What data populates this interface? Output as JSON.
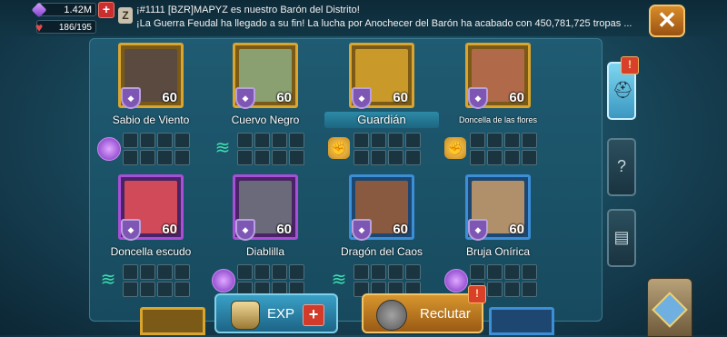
{
  "resources": {
    "gems": "1.42M",
    "stamina": "186/195"
  },
  "chat": {
    "line1": "¡#1111 [BZR]MAPYZ es nuestro Barón del Distrito!",
    "line2": "¡La Guerra Feudal ha llegado a su fin! La lucha por Anochecer del Barón ha acabado con 450,781,725 tropas ..."
  },
  "heroes": [
    {
      "name": "Sabio de Viento",
      "level": "60",
      "frame": "gold",
      "type": "magic",
      "color": "#5a4a40"
    },
    {
      "name": "Cuervo Negro",
      "level": "60",
      "frame": "gold",
      "type": "wind",
      "color": "#8aa070"
    },
    {
      "name": "Guardián",
      "level": "60",
      "frame": "gold",
      "type": "fist",
      "color": "#c99a2a"
    },
    {
      "name": "Doncella de las flores",
      "level": "60",
      "frame": "gold",
      "type": "fist",
      "color": "#b06a4a"
    },
    {
      "name": "Doncella escudo",
      "level": "60",
      "frame": "purple",
      "type": "wind",
      "color": "#d04a5a"
    },
    {
      "name": "Diablilla",
      "level": "60",
      "frame": "purple",
      "type": "magic",
      "color": "#6a6a7a"
    },
    {
      "name": "Dragón del Caos",
      "level": "60",
      "frame": "blue",
      "type": "wind",
      "color": "#8a5a40"
    },
    {
      "name": "Bruja Onírica",
      "level": "60",
      "frame": "blue",
      "type": "magic",
      "color": "#b0906a"
    }
  ],
  "buttons": {
    "exp": "EXP",
    "recruit": "Reclutar",
    "close": "✕",
    "plus": "+",
    "alert": "!"
  },
  "colors": {
    "accent": "#d9a52e",
    "exp_button": "#2b86ab",
    "recruit_button": "#c07c22"
  }
}
